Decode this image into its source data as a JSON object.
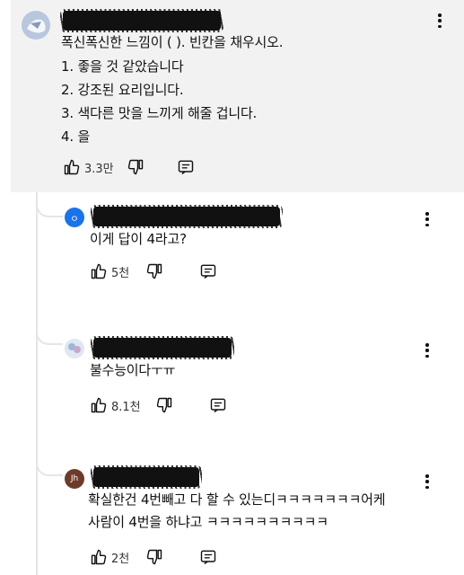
{
  "top_comment": {
    "lines": [
      "폭신폭신한 느낌이 (               ). 빈칸을 채우시오.",
      "1. 좋을 것 같았습니다",
      "2. 강조된 요리입니다.",
      "3. 색다른 맛을 느끼게 해줄 겁니다.",
      "4. 을"
    ],
    "like_count": "3.3만"
  },
  "replies": [
    {
      "avatar_label": "ㅇ",
      "avatar_color": "#1a73e8",
      "lines": [
        "이게 답이 4라고?"
      ],
      "like_count": "5천"
    },
    {
      "avatar_label": "",
      "avatar_color": "#d9e3f0",
      "lines": [
        "불수능이다ㅜㅠ"
      ],
      "like_count": "8.1천"
    },
    {
      "avatar_label": "Jh",
      "avatar_color": "#6d3b2a",
      "lines": [
        "확실한건 4번빼고 다 할 수 있는디ㅋㅋㅋㅋㅋㅋㅋ어케",
        "사람이 4번을 하냐고 ㅋㅋㅋㅋㅋㅋㅋㅋㅋㅋ"
      ],
      "like_count": "2천"
    }
  ],
  "icons": {
    "like": "thumbs-up-icon",
    "dislike": "thumbs-down-icon",
    "reply": "comment-icon",
    "menu": "more-vertical-icon"
  },
  "colors": {
    "top_comment_bg": "#f2f2f2",
    "thread_line": "#e5e5e5"
  }
}
